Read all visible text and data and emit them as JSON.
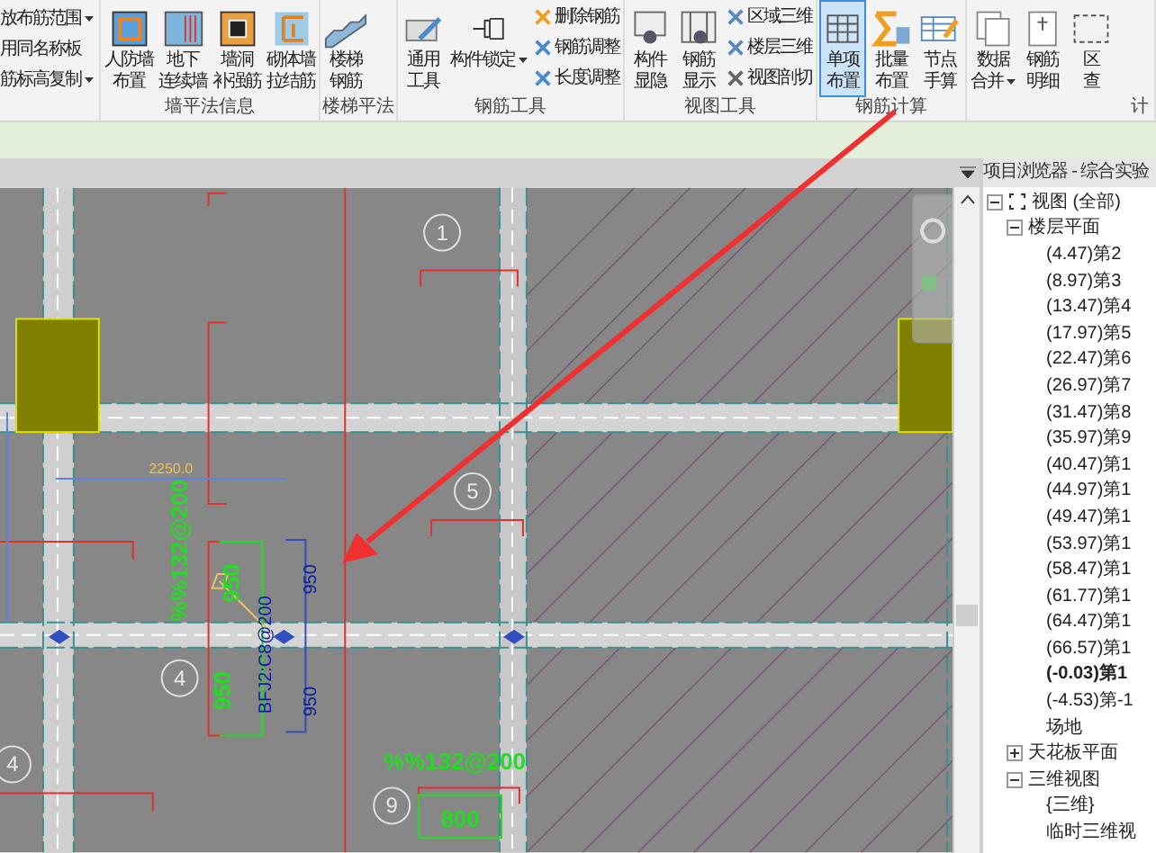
{
  "ribbon": {
    "partial_items": [
      {
        "label": "放布筋范围",
        "dropdown": true
      },
      {
        "label": "用同名称板",
        "dropdown": false
      },
      {
        "label": "筋标高复制",
        "dropdown": true
      }
    ],
    "groups": [
      {
        "title": "墙平法信息",
        "buttons": [
          {
            "kind": "large",
            "lines": [
              "人防墙",
              "布置"
            ],
            "selected": false,
            "dropdown": false
          },
          {
            "kind": "large",
            "lines": [
              "地下",
              "连续墙"
            ],
            "selected": false,
            "dropdown": false
          },
          {
            "kind": "large",
            "lines": [
              "墙洞",
              "补强筋"
            ],
            "selected": false,
            "dropdown": false
          },
          {
            "kind": "large",
            "lines": [
              "砌体墙",
              "拉结筋"
            ],
            "selected": false,
            "dropdown": false
          }
        ]
      },
      {
        "title": "楼梯平法",
        "buttons": [
          {
            "kind": "large",
            "lines": [
              "楼梯",
              "钢筋"
            ],
            "selected": false,
            "dropdown": false
          }
        ]
      },
      {
        "title": "钢筋工具",
        "buttons": [
          {
            "kind": "large",
            "lines": [
              "通用",
              "工具"
            ],
            "selected": false,
            "dropdown": false
          },
          {
            "kind": "large",
            "lines": [
              "构件锁定"
            ],
            "selected": false,
            "dropdown": true
          },
          {
            "kind": "small",
            "lines": [
              "删除钢筋"
            ],
            "selected": false,
            "dropdown": false
          },
          {
            "kind": "small",
            "lines": [
              "钢筋调整"
            ],
            "selected": false,
            "dropdown": false
          },
          {
            "kind": "small",
            "lines": [
              "长度调整"
            ],
            "selected": false,
            "dropdown": false
          }
        ]
      },
      {
        "title": "视图工具",
        "buttons": [
          {
            "kind": "large",
            "lines": [
              "构件",
              "显隐"
            ],
            "selected": false,
            "dropdown": false
          },
          {
            "kind": "large",
            "lines": [
              "钢筋",
              "显示"
            ],
            "selected": false,
            "dropdown": false
          },
          {
            "kind": "small",
            "lines": [
              "区域三维"
            ],
            "selected": false,
            "dropdown": false
          },
          {
            "kind": "small",
            "lines": [
              "楼层三维"
            ],
            "selected": false,
            "dropdown": false
          },
          {
            "kind": "small",
            "lines": [
              "视图剖切"
            ],
            "selected": false,
            "dropdown": false
          }
        ]
      },
      {
        "title": "钢筋计算",
        "buttons": [
          {
            "kind": "large",
            "lines": [
              "单项",
              "布置"
            ],
            "selected": true,
            "dropdown": false
          },
          {
            "kind": "large",
            "lines": [
              "批量",
              "布置"
            ],
            "selected": false,
            "dropdown": false
          },
          {
            "kind": "large",
            "lines": [
              "节点",
              "手算"
            ],
            "selected": false,
            "dropdown": false
          }
        ]
      },
      {
        "title": "计",
        "buttons": [
          {
            "kind": "large",
            "lines": [
              "数据",
              "合并"
            ],
            "selected": false,
            "dropdown": true
          },
          {
            "kind": "large",
            "lines": [
              "钢筋",
              "明细"
            ],
            "selected": false,
            "dropdown": false
          },
          {
            "kind": "large",
            "lines": [
              "区",
              "查"
            ],
            "selected": false,
            "dropdown": false
          }
        ]
      }
    ]
  },
  "canvas": {
    "labels": [
      {
        "text": "1",
        "kind": "bubble"
      },
      {
        "text": "5",
        "kind": "bubble"
      },
      {
        "text": "4",
        "kind": "bubble"
      },
      {
        "text": "4",
        "kind": "bubble"
      },
      {
        "text": "9",
        "kind": "bubble"
      },
      {
        "text": "%%132@200",
        "kind": "rebar"
      },
      {
        "text": "950",
        "kind": "rebar"
      },
      {
        "text": "950",
        "kind": "rebar"
      },
      {
        "text": "BFJ2:C8@200",
        "kind": "dimension"
      },
      {
        "text": "950",
        "kind": "dimension"
      },
      {
        "text": "950",
        "kind": "dimension"
      },
      {
        "text": "%%132@200",
        "kind": "rebar"
      },
      {
        "text": "800",
        "kind": "rebar"
      },
      {
        "text": "2250.0",
        "kind": "temporary"
      }
    ]
  },
  "browser": {
    "title": "项目浏览器 - 综合实验",
    "tree": [
      {
        "label": "视图 (全部)",
        "expanded": true,
        "children": [
          {
            "label": "楼层平面",
            "expanded": true,
            "children": [
              {
                "label": "(4.47)第2",
                "active": false
              },
              {
                "label": "(8.97)第3",
                "active": false
              },
              {
                "label": "(13.47)第4",
                "active": false
              },
              {
                "label": "(17.97)第5",
                "active": false
              },
              {
                "label": "(22.47)第6",
                "active": false
              },
              {
                "label": "(26.97)第7",
                "active": false
              },
              {
                "label": "(31.47)第8",
                "active": false
              },
              {
                "label": "(35.97)第9",
                "active": false
              },
              {
                "label": "(40.47)第1",
                "active": false
              },
              {
                "label": "(44.97)第1",
                "active": false
              },
              {
                "label": "(49.47)第1",
                "active": false
              },
              {
                "label": "(53.97)第1",
                "active": false
              },
              {
                "label": "(58.47)第1",
                "active": false
              },
              {
                "label": "(61.77)第1",
                "active": false
              },
              {
                "label": "(64.47)第1",
                "active": false
              },
              {
                "label": "(66.57)第1",
                "active": false
              },
              {
                "label": "(-0.03)第1",
                "active": true
              },
              {
                "label": "(-4.53)第-1",
                "active": false
              },
              {
                "label": "场地",
                "active": false
              }
            ]
          },
          {
            "label": "天花板平面",
            "expanded": false
          },
          {
            "label": "三维视图",
            "expanded": true,
            "children": [
              {
                "label": "{三维}",
                "active": false
              },
              {
                "label": "临时三维视",
                "active": false
              }
            ]
          }
        ]
      }
    ]
  }
}
